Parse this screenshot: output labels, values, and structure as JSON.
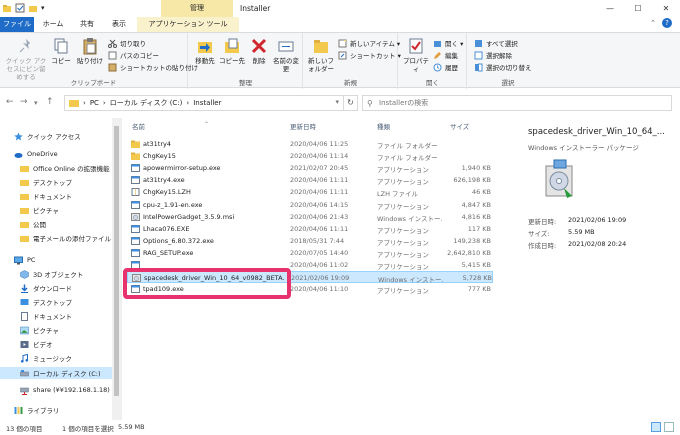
{
  "window": {
    "context_tab": "管理",
    "title": "Installer"
  },
  "ribbon_tabs": [
    "ファイル",
    "ホーム",
    "共有",
    "表示",
    "アプリケーション ツール"
  ],
  "ribbon": {
    "clipboard": {
      "label": "クリップボード",
      "pin": "クイック アクセスにピン留めする",
      "copy": "コピー",
      "paste": "貼り付け",
      "cut": "切り取り",
      "copy_path": "パスのコピー",
      "paste_shortcut": "ショートカットの貼り付け"
    },
    "organize": {
      "label": "整理",
      "move_to": "移動先",
      "copy_to": "コピー先",
      "delete": "削除",
      "rename": "名前の変更"
    },
    "new": {
      "label": "新規",
      "new_folder": "新しいフォルダー",
      "new_item": "新しいアイテム ▾",
      "shortcut": "ショートカット ▾"
    },
    "open": {
      "label": "開く",
      "properties": "プロパティ",
      "open": "開く ▾",
      "edit": "編集",
      "history": "履歴"
    },
    "select": {
      "label": "選択",
      "select_all": "すべて選択",
      "select_none": "選択解除",
      "invert": "選択の切り替え"
    }
  },
  "address": {
    "parts": [
      "PC",
      "ローカル ディスク (C:)",
      "Installer"
    ],
    "search_placeholder": "Installerの検索"
  },
  "nav": {
    "items": [
      {
        "label": "クイック アクセス",
        "icon": "star-icon"
      },
      {
        "label": "OneDrive",
        "icon": "cloud-icon"
      },
      {
        "label": "Office Online の拡張機能",
        "icon": "folder-icon"
      },
      {
        "label": "デスクトップ",
        "icon": "folder-icon"
      },
      {
        "label": "ドキュメント",
        "icon": "folder-icon"
      },
      {
        "label": "ピクチャ",
        "icon": "folder-icon"
      },
      {
        "label": "公開",
        "icon": "folder-icon"
      },
      {
        "label": "電子メールの添付ファイル",
        "icon": "folder-icon"
      },
      {
        "label": "PC",
        "icon": "pc-icon"
      },
      {
        "label": "3D オブジェクト",
        "icon": "cube-icon"
      },
      {
        "label": "ダウンロード",
        "icon": "download-icon"
      },
      {
        "label": "デスクトップ",
        "icon": "desktop-icon"
      },
      {
        "label": "ドキュメント",
        "icon": "document-icon"
      },
      {
        "label": "ピクチャ",
        "icon": "picture-icon"
      },
      {
        "label": "ビデオ",
        "icon": "video-icon"
      },
      {
        "label": "ミュージック",
        "icon": "music-icon"
      },
      {
        "label": "ローカル ディスク (C:)",
        "icon": "drive-icon"
      },
      {
        "label": "share (¥¥192.168.1.18) (Z:)",
        "icon": "network-drive-icon"
      },
      {
        "label": "ライブラリ",
        "icon": "library-icon"
      }
    ]
  },
  "columns": {
    "name": "名前",
    "date": "更新日時",
    "type": "種類",
    "size": "サイズ"
  },
  "files": [
    {
      "name": "at31try4",
      "date": "2020/04/06 11:25",
      "type": "ファイル フォルダー",
      "size": "",
      "icon": "folder-icon"
    },
    {
      "name": "ChgKey15",
      "date": "2020/04/06 11:14",
      "type": "ファイル フォルダー",
      "size": "",
      "icon": "folder-icon"
    },
    {
      "name": "apowermirror-setup.exe",
      "date": "2021/02/07 20:45",
      "type": "アプリケーション",
      "size": "1,940 KB",
      "icon": "exe-icon"
    },
    {
      "name": "at31try4.exe",
      "date": "2020/04/06 11:11",
      "type": "アプリケーション",
      "size": "626,198 KB",
      "icon": "exe-icon"
    },
    {
      "name": "ChgKey15.LZH",
      "date": "2020/04/06 11:11",
      "type": "LZH ファイル",
      "size": "46 KB",
      "icon": "archive-icon"
    },
    {
      "name": "cpu-z_1.91-en.exe",
      "date": "2020/04/06 14:15",
      "type": "アプリケーション",
      "size": "4,847 KB",
      "icon": "exe-icon"
    },
    {
      "name": "IntelPowerGadget_3.5.9.msi",
      "date": "2020/04/06 21:43",
      "type": "Windows インストー...",
      "size": "4,816 KB",
      "icon": "msi-icon"
    },
    {
      "name": "Lhaca076.EXE",
      "date": "2020/04/06 11:11",
      "type": "アプリケーション",
      "size": "117 KB",
      "icon": "exe-icon"
    },
    {
      "name": "Options_6.80.372.exe",
      "date": "2018/05/31 7:44",
      "type": "アプリケーション",
      "size": "149,238 KB",
      "icon": "exe-icon"
    },
    {
      "name": "RAG_SETUP.exe",
      "date": "2020/07/05 14:40",
      "type": "アプリケーション",
      "size": "2,642,810 KB",
      "icon": "exe-icon"
    },
    {
      "name": "",
      "date": "2020/04/06 11:02",
      "type": "アプリケーション",
      "size": "5,415 KB",
      "icon": "exe-icon"
    },
    {
      "name": "spacedesk_driver_Win_10_64_v0982_BETA....",
      "date": "2021/02/06 19:09",
      "type": "Windows インストー...",
      "size": "5,728 KB",
      "icon": "msi-icon",
      "selected": true
    },
    {
      "name": "tpad109.exe",
      "date": "2020/04/06 11:10",
      "type": "アプリケーション",
      "size": "777 KB",
      "icon": "exe-icon"
    }
  ],
  "preview": {
    "title": "spacedesk_driver_Win_10_64_...",
    "type": "Windows インストーラー パッケージ",
    "meta": [
      {
        "label": "更新日時:",
        "value": "2021/02/06 19:09"
      },
      {
        "label": "サイズ:",
        "value": "5.59 MB"
      },
      {
        "label": "作成日時:",
        "value": "2021/02/08 20:24"
      }
    ]
  },
  "status": {
    "count": "13 個の項目",
    "selected": "1 個の項目を選択",
    "size": "5.59 MB"
  }
}
